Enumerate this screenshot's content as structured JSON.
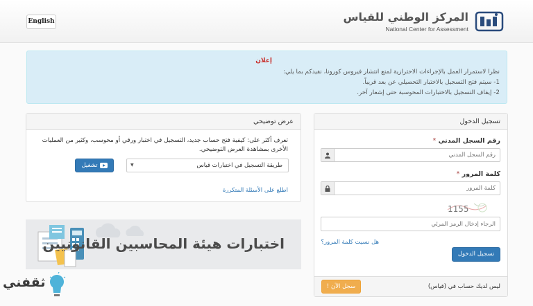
{
  "header": {
    "language_button": "English",
    "logo_ar": "المركز الوطني للقياس",
    "logo_en": "National Center for Assessment"
  },
  "announcement": {
    "title": "إعلان",
    "line1": "نظرا لاستمرار العمل بالإجراءات الاحترازية لمنع انتشار فيروس كورونا، نفيدكم بما يلي:",
    "line2": "1-  سيتم فتح التسجيل بالاختبار التحصيلي عن بعد قريباً.",
    "line3": "2- إيقاف التسجيل بالاختبارات المحوسبة حتى إشعار آخر."
  },
  "login": {
    "title": "تسجيل الدخول",
    "id_label": "رقم السجل المدني",
    "id_placeholder": "رقم السجل المدني",
    "password_label": "كلمة المرور",
    "password_placeholder": "كلمة المرور",
    "captcha_code": "1155",
    "captcha_placeholder": "الرجاء إدخال الرمز المرئي",
    "forgot_link": "هل نسيت كلمة المرور؟",
    "submit_button": "تسجيل الدخول",
    "no_account_text": "ليس لديك حساب في (قياس)",
    "register_button": "سجل الآن !"
  },
  "demo": {
    "title": "عرض توضيحي",
    "description": "تعرف أكثر على: كيفية فتح حساب جديد، التسجيل في اختبار ورقي أو محوسب، وكثير من العمليات الأخرى بمشاهدة العرض التوضيحي.",
    "select_value": "طريقة التسجيل في اختبارات قياس",
    "play_button": "تشغيل",
    "faq_link": "اطلع على الأسئلة المتكررة"
  },
  "banner": {
    "text": "اختبارات هيئة المحاسبين القانونيين"
  },
  "watermark": {
    "text": "ثقفني"
  },
  "colors": {
    "primary": "#337ab7",
    "warning": "#f0ad4e",
    "alert_bg": "#d9edf7",
    "alert_title": "#c9302c"
  }
}
